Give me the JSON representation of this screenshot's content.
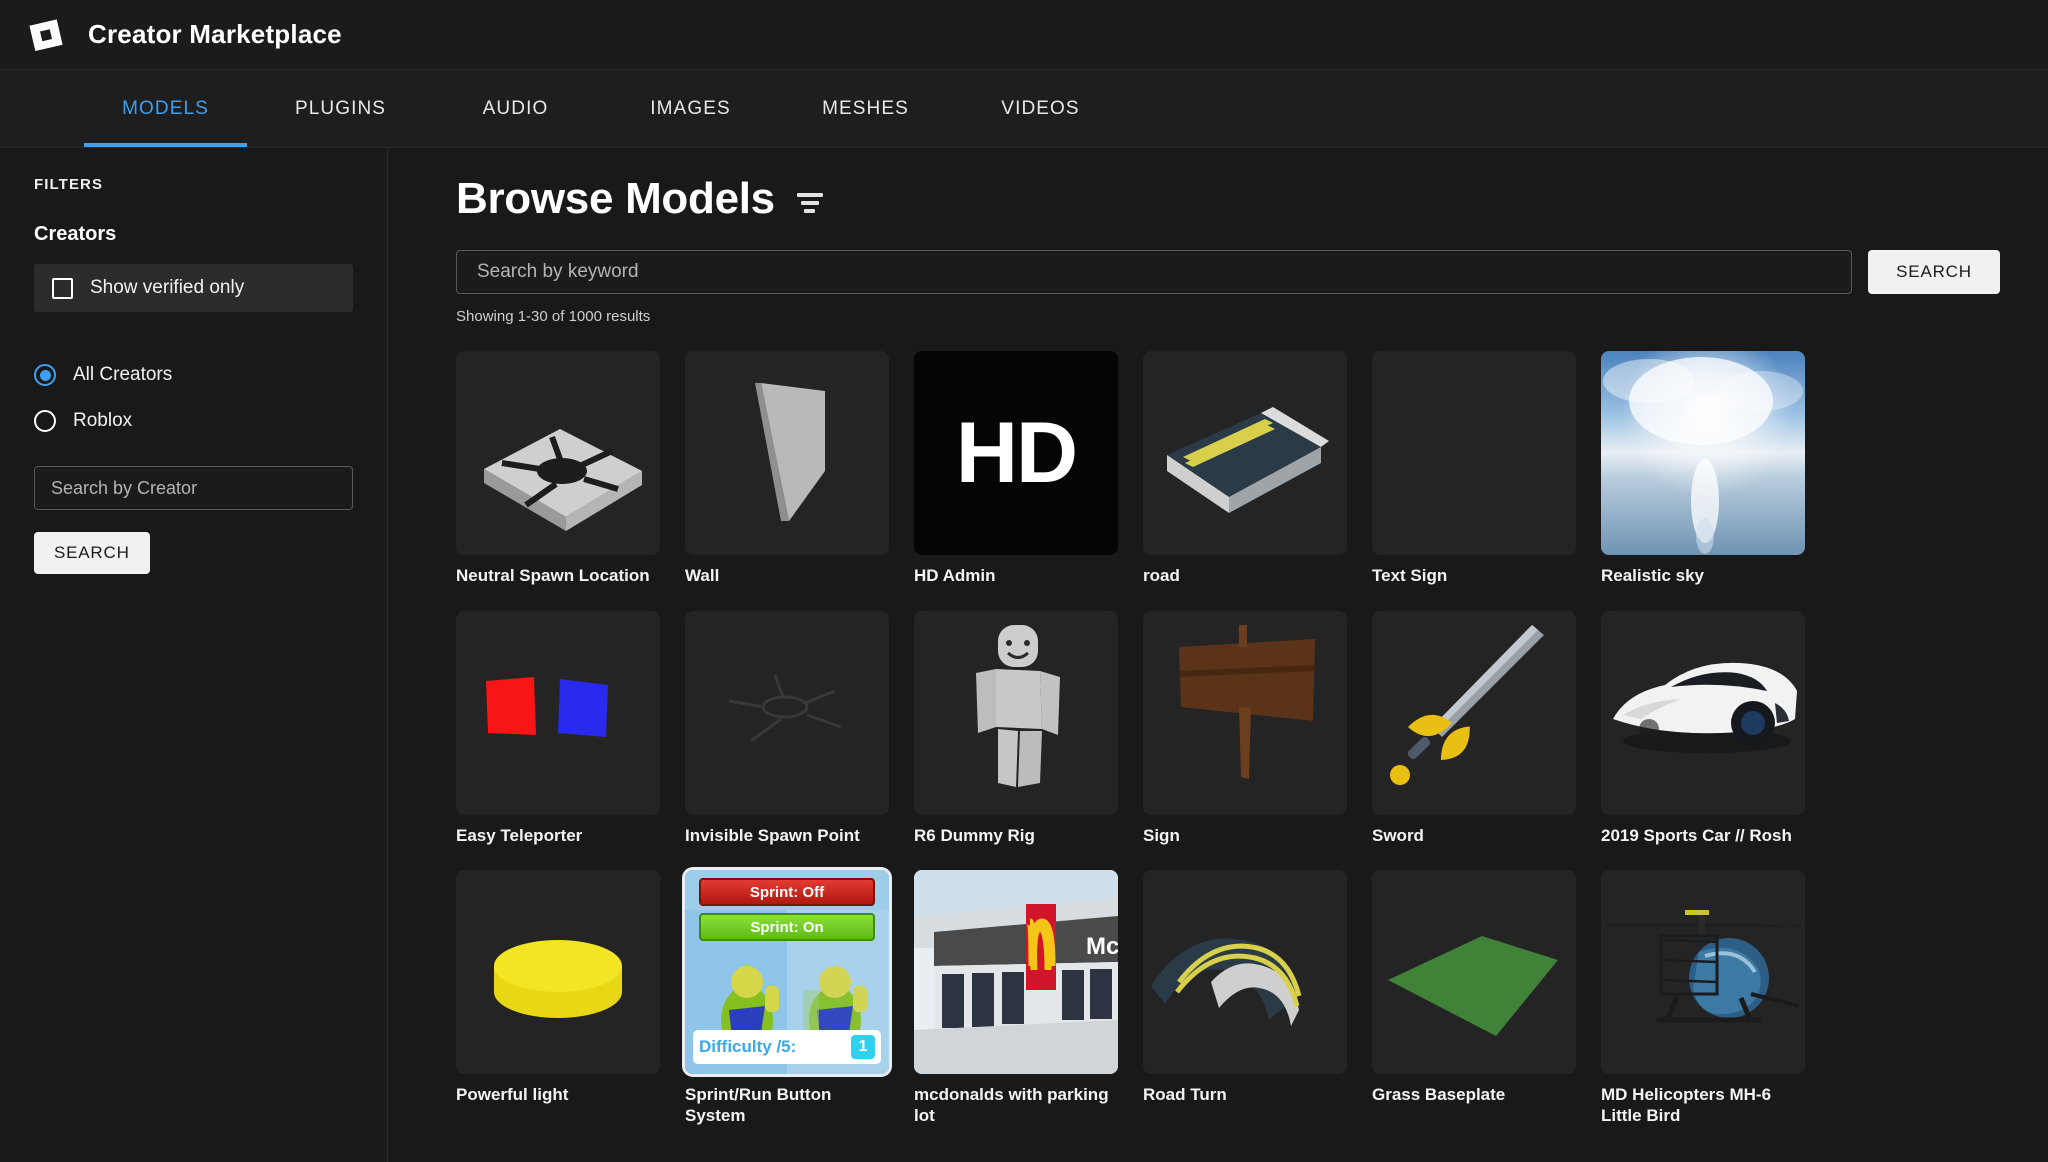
{
  "header": {
    "title": "Creator Marketplace",
    "logo_icon": "roblox-logo-icon"
  },
  "tabs": [
    {
      "label": "MODELS",
      "active": true
    },
    {
      "label": "PLUGINS",
      "active": false
    },
    {
      "label": "AUDIO",
      "active": false
    },
    {
      "label": "IMAGES",
      "active": false
    },
    {
      "label": "MESHES",
      "active": false
    },
    {
      "label": "VIDEOS",
      "active": false
    }
  ],
  "sidebar": {
    "filters_label": "FILTERS",
    "creators_group_title": "Creators",
    "verified_checkbox_label": "Show verified only",
    "verified_checked": false,
    "radios": [
      {
        "label": "All Creators",
        "selected": true
      },
      {
        "label": "Roblox",
        "selected": false
      }
    ],
    "creator_search_placeholder": "Search by Creator",
    "creator_search_value": "",
    "search_button_label": "SEARCH"
  },
  "main": {
    "page_title": "Browse Models",
    "filter_icon": "filter-icon",
    "keyword_placeholder": "Search by keyword",
    "keyword_value": "",
    "search_button_label": "SEARCH",
    "results_count": "Showing 1-30 of 1000 results"
  },
  "accent_color": "#3f9ff0",
  "results": [
    {
      "title": "Neutral Spawn Location",
      "art": "spawn-pad",
      "selected": false
    },
    {
      "title": "Wall",
      "art": "wall",
      "selected": false
    },
    {
      "title": "HD Admin",
      "art": "hd-admin",
      "selected": false
    },
    {
      "title": "road",
      "art": "road",
      "selected": false
    },
    {
      "title": "Text Sign",
      "art": "empty",
      "selected": false
    },
    {
      "title": "Realistic sky",
      "art": "sky",
      "selected": false
    },
    {
      "title": "Easy Teleporter",
      "art": "teleporter",
      "selected": false
    },
    {
      "title": "Invisible Spawn Point",
      "art": "invisible-spawn",
      "selected": false
    },
    {
      "title": "R6 Dummy Rig",
      "art": "dummy",
      "selected": false
    },
    {
      "title": "Sign",
      "art": "wood-sign",
      "selected": false
    },
    {
      "title": "Sword",
      "art": "sword",
      "selected": false
    },
    {
      "title": "2019 Sports Car // Rosh",
      "art": "sports-car",
      "selected": false
    },
    {
      "title": "Powerful light",
      "art": "yellow-cylinder",
      "selected": false
    },
    {
      "title": "Sprint/Run Button System",
      "art": "sprint-system",
      "selected": true
    },
    {
      "title": "mcdonalds with parking lot",
      "art": "mcdonalds",
      "selected": false
    },
    {
      "title": "Road Turn",
      "art": "road-turn",
      "selected": false
    },
    {
      "title": "Grass Baseplate",
      "art": "grass-baseplate",
      "selected": false
    },
    {
      "title": "MD Helicopters MH-6 Little Bird",
      "art": "helicopter",
      "selected": false
    }
  ],
  "sprint_thumb": {
    "off_label": "Sprint: Off",
    "on_label": "Sprint: On",
    "difficulty_label": "Difficulty /5:",
    "difficulty_value": "1"
  },
  "hd_admin_thumb": {
    "text": "HD"
  },
  "mcdonalds_thumb": {
    "text": "McD"
  }
}
